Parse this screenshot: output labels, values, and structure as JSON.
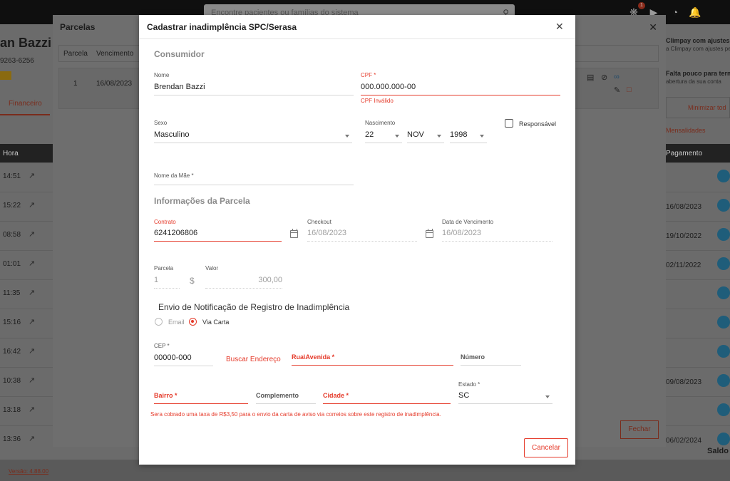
{
  "background": {
    "search_placeholder": "Encontre pacientes ou famílias do sistema",
    "notification_count": "1",
    "patient_name": "an Bazzi (",
    "patient_phone": "9263-6256",
    "financeiro_tab": "Financeiro",
    "hora_header": "Hora",
    "pagamento_header": "Pagamento",
    "times": [
      "14:51",
      "15:22",
      "08:58",
      "01:01",
      "11:35",
      "15:16",
      "16:42",
      "10:38",
      "13:18",
      "13:36"
    ],
    "payments": [
      "",
      "16/08/2023",
      "19/10/2022",
      "02/11/2022",
      "",
      "",
      "",
      "09/08/2023",
      "",
      "06/02/2024"
    ],
    "right_note1_title": "Climpay com ajustes per",
    "right_note1_sub": "a Climpay com ajustes pe",
    "right_note2_title": "Falta pouco para term",
    "right_note2_sub": "abertura da sua conta",
    "minimize_label": "Minimizar tod",
    "mensalidades_label": "Mensalidades",
    "saldo_label": "Saldo",
    "version_label": "Versão: 4.88.00"
  },
  "parcelas_dialog": {
    "title": "Parcelas",
    "col_parcela": "Parcela",
    "col_vencimento": "Vencimento",
    "row_parcela": "1",
    "row_vencimento": "16/08/2023",
    "fechar_label": "Fechar"
  },
  "modal": {
    "title": "Cadastrar inadimplência SPC/Serasa",
    "consumidor_title": "Consumidor",
    "nome_label": "Nome",
    "nome_value": "Brendan Bazzi",
    "cpf_label": "CPF *",
    "cpf_value": "000.000.000-00",
    "cpf_error": "CPF Inválido",
    "sexo_label": "Sexo",
    "sexo_value": "Masculino",
    "nascimento_label": "Nascimento",
    "nasc_day": "22",
    "nasc_month": "NOV",
    "nasc_year": "1998",
    "responsavel_label": "Responsável",
    "nome_mae_label": "Nome da Mãe *",
    "parcela_info_title": "Informações da Parcela",
    "contrato_label": "Contrato",
    "contrato_value": "6241206806",
    "checkout_label": "Checkout",
    "checkout_value": "16/08/2023",
    "vencimento_label": "Data de Vencimento",
    "vencimento_value": "16/08/2023",
    "parcela_label": "Parcela",
    "parcela_value": "1",
    "currency_symbol": "$",
    "valor_label": "Valor",
    "valor_value": "300,00",
    "notif_title": "Envio de Notificação de Registro de Inadimplência",
    "radio_email": "Email",
    "radio_carta": "Via Carta",
    "cep_label": "CEP *",
    "cep_value": "00000-000",
    "buscar_label": "Buscar Endereço",
    "rua_label": "Rua\\Avenida *",
    "numero_label": "Número",
    "bairro_label": "Bairro *",
    "complemento_label": "Complemento",
    "cidade_label": "Cidade *",
    "estado_label": "Estado *",
    "estado_value": "SC",
    "fee_note": "Sera cobrado uma taxa de R$3,50 para o envio da carta de aviso via correios sobre este registro de inadimplência.",
    "cancel_label": "Cancelar"
  },
  "colors": {
    "accent": "#e53a2a",
    "overlay": "#5d5d5d"
  }
}
